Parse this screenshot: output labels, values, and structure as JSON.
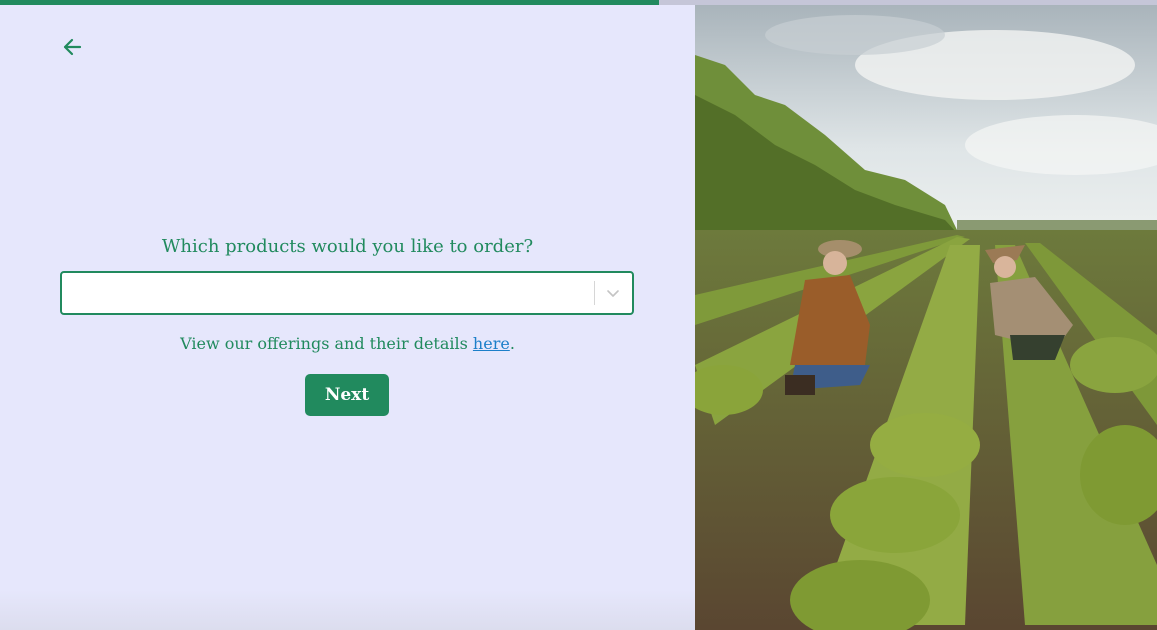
{
  "progress": {
    "fraction": 0.57
  },
  "back": {
    "icon": "arrow-left-icon"
  },
  "question": {
    "text": "Which products would you like to order?"
  },
  "select": {
    "value": "",
    "icon": "chevron-down-icon"
  },
  "helper": {
    "prefix": "View our offerings and their details ",
    "link": "here",
    "suffix": "."
  },
  "next_button": {
    "label": "Next"
  },
  "colors": {
    "accent": "#218a5e",
    "background": "#e6e7fc",
    "link": "#1c7fc9"
  },
  "image": {
    "subject": "farm-field-photo"
  }
}
